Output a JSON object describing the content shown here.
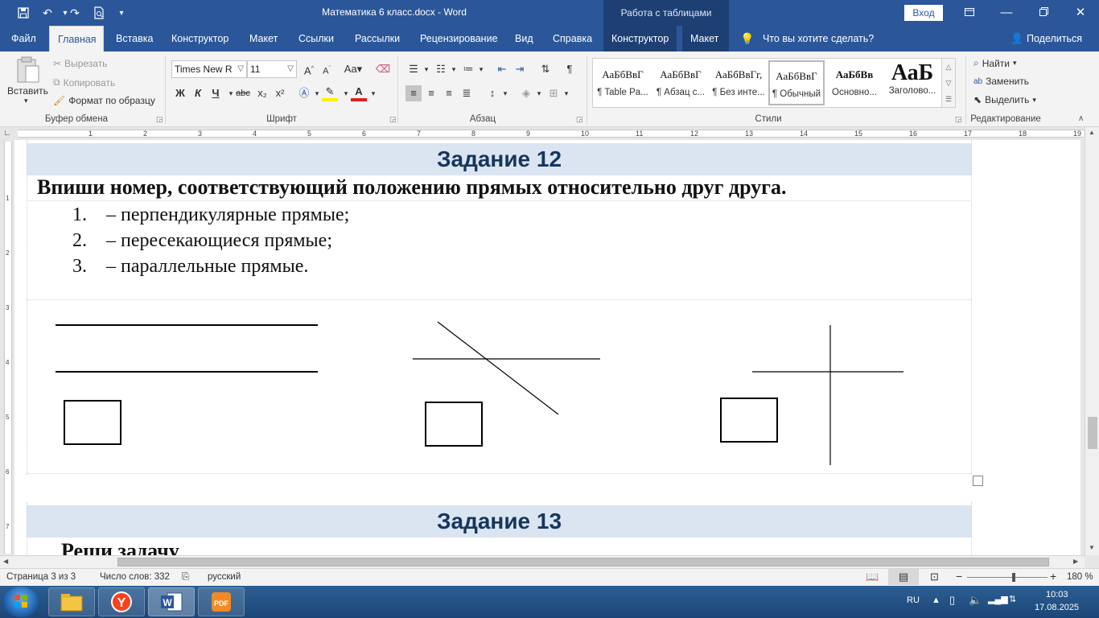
{
  "titlebar": {
    "doc_title": "Математика 6 класс.docx  -  Word",
    "context_group": "Работа с таблицами",
    "signin": "Вход",
    "icons": [
      "save-icon",
      "undo-icon",
      "redo-icon",
      "print-preview-icon",
      "customize-qa-icon"
    ]
  },
  "tabs": [
    {
      "label": "Файл"
    },
    {
      "label": "Главная"
    },
    {
      "label": "Вставка"
    },
    {
      "label": "Конструктор"
    },
    {
      "label": "Макет"
    },
    {
      "label": "Ссылки"
    },
    {
      "label": "Рассылки"
    },
    {
      "label": "Рецензирование"
    },
    {
      "label": "Вид"
    },
    {
      "label": "Справка"
    },
    {
      "label": "Конструктор"
    },
    {
      "label": "Макет"
    }
  ],
  "tell_me": "Что вы хотите сделать?",
  "share": "Поделиться",
  "ribbon": {
    "clipboard": {
      "paste": "Вставить",
      "cut": "Вырезать",
      "copy": "Копировать",
      "format_painter": "Формат по образцу",
      "label": "Буфер обмена"
    },
    "font": {
      "font_name": "Times New R",
      "font_size": "11",
      "bold": "Ж",
      "italic": "К",
      "underline": "Ч",
      "strike": "abc",
      "subscript": "x₂",
      "superscript": "x²",
      "label": "Шрифт"
    },
    "paragraph": {
      "label": "Абзац"
    },
    "styles": {
      "items": [
        {
          "preview": "АаБбВвГ",
          "name": "¶ Table Pa..."
        },
        {
          "preview": "АаБбВвГ",
          "name": "¶ Абзац с..."
        },
        {
          "preview": "АаБбВвГг,",
          "name": "¶ Без инте..."
        },
        {
          "preview": "АаБбВвГ",
          "name": "¶ Обычный"
        },
        {
          "preview": "АаБбВв",
          "name": "Основно..."
        },
        {
          "preview": "АаБ",
          "name": "Заголово..."
        }
      ],
      "label": "Стили"
    },
    "editing": {
      "find": "Найти",
      "replace": "Заменить",
      "select": "Выделить",
      "label": "Редактирование"
    }
  },
  "ruler": {
    "h_ticks": [
      "1",
      "2",
      "3",
      "4",
      "5",
      "6",
      "7",
      "8",
      "9",
      "10",
      "11",
      "12",
      "13",
      "14",
      "15",
      "16",
      "17",
      "18",
      "19"
    ],
    "v_ticks": [
      "1",
      "2",
      "3",
      "4",
      "5",
      "6",
      "7"
    ]
  },
  "document": {
    "task12_title": "Задание 12",
    "instruction": "Впиши номер, соответствующий положению прямых относительно друг друга.",
    "list": [
      {
        "num": "1.",
        "text": "– перпендикулярные прямые;"
      },
      {
        "num": "2.",
        "text": "– пересекающиеся прямые;"
      },
      {
        "num": "3.",
        "text": "– параллельные прямые."
      }
    ],
    "figures": [
      "parallel-lines",
      "intersecting-lines",
      "perpendicular-lines"
    ],
    "task13_title": "Задание 13",
    "task13_text": "Реши задачу"
  },
  "status": {
    "page": "Страница 3 из 3",
    "words": "Число слов: 332",
    "language": "русский",
    "zoom": "180 %"
  },
  "taskbar": {
    "apps": [
      "explorer",
      "yandex-browser",
      "word",
      "pdf-tool"
    ],
    "lang": "RU",
    "time": "10:03",
    "date": "17.08.2025"
  },
  "colors": {
    "brand": "#2b579a",
    "heading_band": "#dbe5f1",
    "heading_text": "#17365d"
  }
}
